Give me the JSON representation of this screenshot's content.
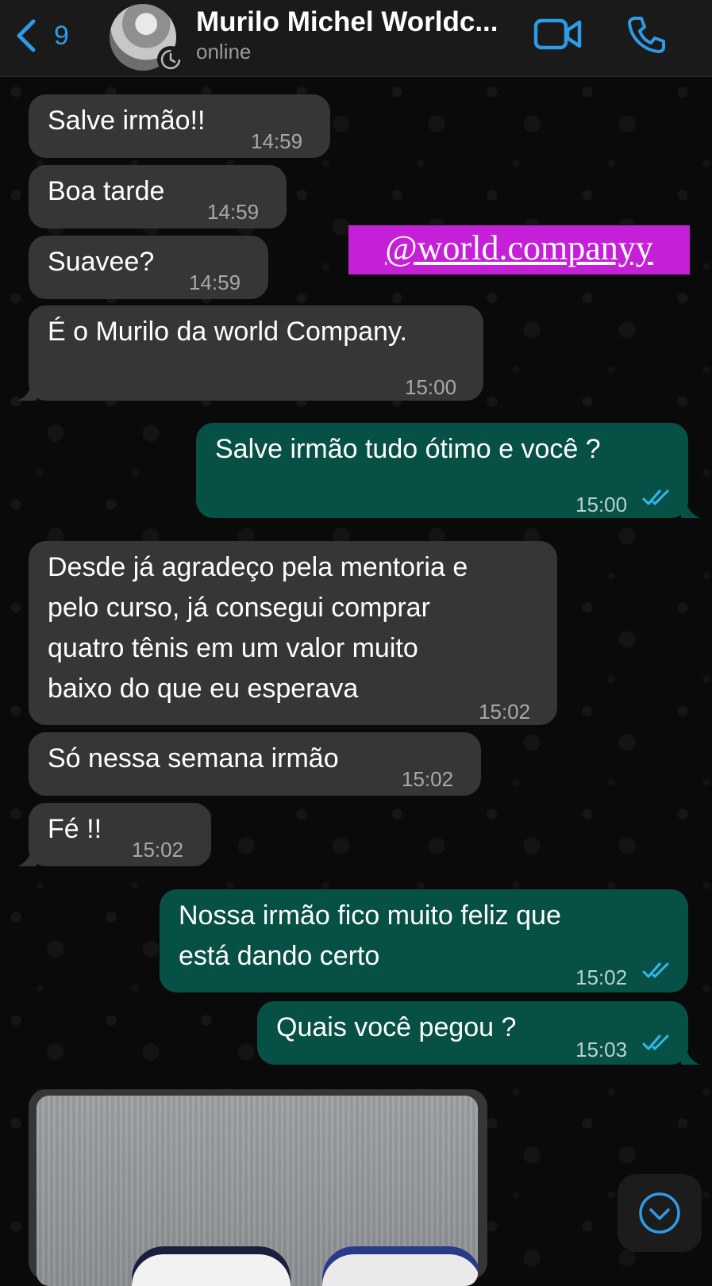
{
  "header": {
    "back_count": "9",
    "contact_name": "Murilo Michel Worldc...",
    "status": "online"
  },
  "overlay": {
    "handle": "@world.companyy"
  },
  "messages": [
    {
      "dir": "in",
      "text": "Salve irmão!!",
      "time": "14:59"
    },
    {
      "dir": "in",
      "text": "Boa tarde",
      "time": "14:59"
    },
    {
      "dir": "in",
      "text": "Suavee?",
      "time": "14:59"
    },
    {
      "dir": "in",
      "text": "É o Murilo da world Company.",
      "time": "15:00"
    },
    {
      "dir": "out",
      "text": "Salve irmão tudo ótimo e você ?",
      "time": "15:00",
      "status": "read"
    },
    {
      "dir": "in",
      "text": "Desde já agradeço pela mentoria e\npelo curso, já consegui comprar\nquatro tênis em um valor muito\nbaixo do que eu esperava",
      "time": "15:02"
    },
    {
      "dir": "in",
      "text": "Só nessa semana irmão",
      "time": "15:02"
    },
    {
      "dir": "in",
      "text": "Fé !!",
      "time": "15:02"
    },
    {
      "dir": "out",
      "text": "Nossa irmão fico muito feliz que\nestá dando certo",
      "time": "15:02",
      "status": "read"
    },
    {
      "dir": "out",
      "text": "Quais você pegou ?",
      "time": "15:03",
      "status": "read"
    }
  ],
  "colors": {
    "accent": "#2d9be6",
    "incoming_bubble": "#363636",
    "outgoing_bubble": "#075045",
    "overlay_handle_bg": "#c61fd8"
  },
  "icons": {
    "back": "chevron-left-icon",
    "avatar_badge": "timer-icon",
    "video": "video-camera-icon",
    "voice": "phone-icon",
    "ticks": "double-check-icon",
    "scroll": "chevron-down-circle-icon"
  }
}
